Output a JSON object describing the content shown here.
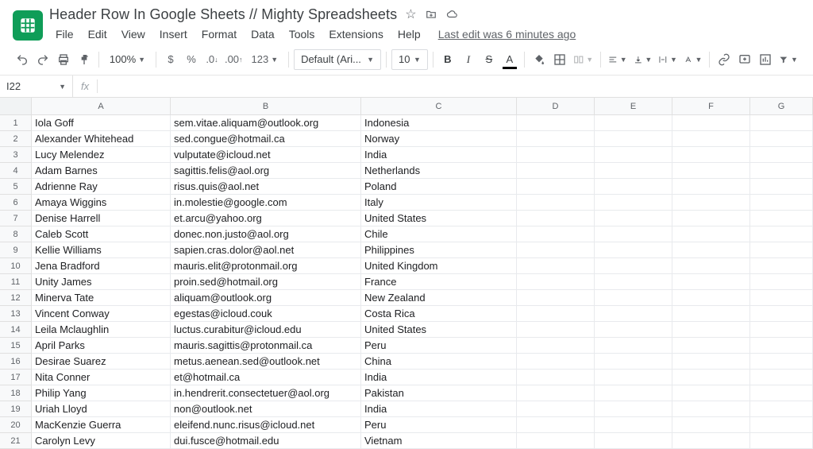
{
  "doc": {
    "title": "Header Row In Google Sheets // Mighty Spreadsheets",
    "last_edit": "Last edit was 6 minutes ago"
  },
  "menu": {
    "file": "File",
    "edit": "Edit",
    "view": "View",
    "insert": "Insert",
    "format": "Format",
    "data": "Data",
    "tools": "Tools",
    "extensions": "Extensions",
    "help": "Help"
  },
  "toolbar": {
    "zoom": "100%",
    "currency": "$",
    "percent": "%",
    "dec_dec": ".0",
    "inc_dec": ".00",
    "more_formats": "123",
    "font": "Default (Ari...",
    "font_size": "10"
  },
  "namebox": {
    "ref": "I22",
    "fx": "fx"
  },
  "columns": [
    "A",
    "B",
    "C",
    "D",
    "E",
    "F",
    "G"
  ],
  "rows": [
    {
      "n": "1",
      "a": "Iola Goff",
      "b": "sem.vitae.aliquam@outlook.org",
      "c": "Indonesia"
    },
    {
      "n": "2",
      "a": "Alexander Whitehead",
      "b": "sed.congue@hotmail.ca",
      "c": "Norway"
    },
    {
      "n": "3",
      "a": "Lucy Melendez",
      "b": "vulputate@icloud.net",
      "c": "India"
    },
    {
      "n": "4",
      "a": "Adam Barnes",
      "b": "sagittis.felis@aol.org",
      "c": "Netherlands"
    },
    {
      "n": "5",
      "a": "Adrienne Ray",
      "b": "risus.quis@aol.net",
      "c": "Poland"
    },
    {
      "n": "6",
      "a": "Amaya Wiggins",
      "b": "in.molestie@google.com",
      "c": "Italy"
    },
    {
      "n": "7",
      "a": "Denise Harrell",
      "b": "et.arcu@yahoo.org",
      "c": "United States"
    },
    {
      "n": "8",
      "a": "Caleb Scott",
      "b": "donec.non.justo@aol.org",
      "c": "Chile"
    },
    {
      "n": "9",
      "a": "Kellie Williams",
      "b": "sapien.cras.dolor@aol.net",
      "c": "Philippines"
    },
    {
      "n": "10",
      "a": "Jena Bradford",
      "b": "mauris.elit@protonmail.org",
      "c": "United Kingdom"
    },
    {
      "n": "11",
      "a": "Unity James",
      "b": "proin.sed@hotmail.org",
      "c": "France"
    },
    {
      "n": "12",
      "a": "Minerva Tate",
      "b": "aliquam@outlook.org",
      "c": "New Zealand"
    },
    {
      "n": "13",
      "a": "Vincent Conway",
      "b": "egestas@icloud.couk",
      "c": "Costa Rica"
    },
    {
      "n": "14",
      "a": "Leila Mclaughlin",
      "b": "luctus.curabitur@icloud.edu",
      "c": "United States"
    },
    {
      "n": "15",
      "a": "April Parks",
      "b": "mauris.sagittis@protonmail.ca",
      "c": "Peru"
    },
    {
      "n": "16",
      "a": "Desirae Suarez",
      "b": "metus.aenean.sed@outlook.net",
      "c": "China"
    },
    {
      "n": "17",
      "a": "Nita Conner",
      "b": "et@hotmail.ca",
      "c": "India"
    },
    {
      "n": "18",
      "a": "Philip Yang",
      "b": "in.hendrerit.consectetuer@aol.org",
      "c": "Pakistan"
    },
    {
      "n": "19",
      "a": "Uriah Lloyd",
      "b": "non@outlook.net",
      "c": "India"
    },
    {
      "n": "20",
      "a": "MacKenzie Guerra",
      "b": "eleifend.nunc.risus@icloud.net",
      "c": "Peru"
    },
    {
      "n": "21",
      "a": "Carolyn Levy",
      "b": "dui.fusce@hotmail.edu",
      "c": "Vietnam"
    }
  ]
}
